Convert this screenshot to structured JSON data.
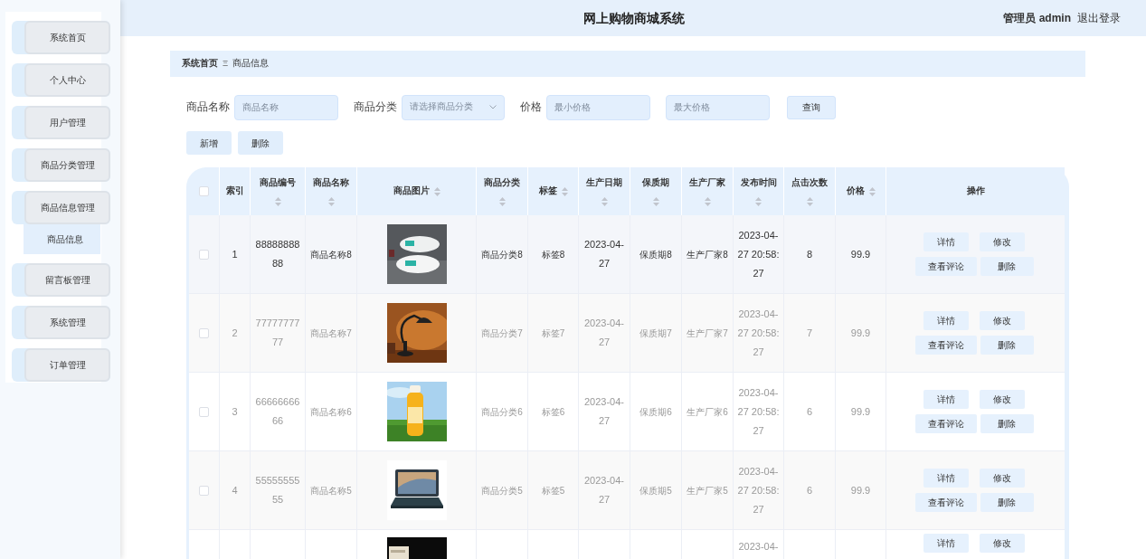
{
  "sidebar": {
    "items": [
      {
        "label": "系统首页",
        "selected": false
      },
      {
        "label": "个人中心",
        "selected": false
      },
      {
        "label": "用户管理",
        "selected": false
      },
      {
        "label": "商品分类管理",
        "selected": false
      },
      {
        "label": "商品信息管理",
        "selected": false,
        "children": [
          {
            "label": "商品信息",
            "selected": true
          }
        ]
      },
      {
        "label": "留言板管理",
        "selected": false
      },
      {
        "label": "系统管理",
        "selected": false
      },
      {
        "label": "订单管理",
        "selected": false
      }
    ]
  },
  "header": {
    "title": "网上购物商城系统",
    "user": "管理员 admin",
    "logout": "退出登录"
  },
  "breadcrumb": {
    "items": [
      "系统首页",
      "商品信息"
    ],
    "separator": "Ξ"
  },
  "search": {
    "fields": [
      {
        "kind": "text",
        "label": "商品名称",
        "placeholder": "商品名称"
      },
      {
        "kind": "select",
        "label": "商品分类",
        "placeholder": "请选择商品分类"
      },
      {
        "kind": "text",
        "label": "价格",
        "placeholder": "最小价格"
      },
      {
        "kind": "text",
        "placeholder": "最大价格"
      }
    ],
    "button": "查询"
  },
  "actions": [
    "新增",
    "删除"
  ],
  "table": {
    "header_checked": false,
    "columns": [
      {
        "label": "索引",
        "sortable": false
      },
      {
        "label": "商品编号",
        "sortable": true
      },
      {
        "label": "商品名称",
        "sortable": true
      },
      {
        "label": "商品图片",
        "sortable": true
      },
      {
        "label": "商品分类",
        "sortable": true
      },
      {
        "label": "标签",
        "sortable": true
      },
      {
        "label": "生产日期",
        "sortable": true
      },
      {
        "label": "保质期",
        "sortable": true
      },
      {
        "label": "生产厂家",
        "sortable": true
      },
      {
        "label": "发布时间",
        "sortable": true
      },
      {
        "label": "点击次数",
        "sortable": true
      },
      {
        "label": "价格",
        "sortable": true
      },
      {
        "label": "操作",
        "sortable": false
      }
    ],
    "rows": [
      {
        "checked": false,
        "highlighted": true,
        "cells": [
          "1",
          "8888888888",
          "商品名称8",
          {
            "kind": "picture"
          },
          "商品分类8",
          "标签8",
          "2023-04-27",
          "保质期8",
          "生产厂家8",
          "2023-04-27 20:58:27",
          "8",
          "99.9"
        ],
        "buttons": [
          "详情",
          "修改",
          "查看评论",
          "删除"
        ]
      },
      {
        "checked": false,
        "highlighted": false,
        "cells": [
          "2",
          "7777777777",
          "商品名称7",
          {
            "kind": "picture"
          },
          "商品分类7",
          "标签7",
          "2023-04-27",
          "保质期7",
          "生产厂家7",
          "2023-04-27 20:58:27",
          "7",
          "99.9"
        ],
        "buttons": [
          "详情",
          "修改",
          "查看评论",
          "删除"
        ]
      },
      {
        "checked": false,
        "highlighted": false,
        "cells": [
          "3",
          "6666666666",
          "商品名称6",
          {
            "kind": "picture"
          },
          "商品分类6",
          "标签6",
          "2023-04-27",
          "保质期6",
          "生产厂家6",
          "2023-04-27 20:58:27",
          "6",
          "99.9"
        ],
        "buttons": [
          "详情",
          "修改",
          "查看评论",
          "删除"
        ]
      },
      {
        "checked": false,
        "highlighted": false,
        "cells": [
          "4",
          "5555555555",
          "商品名称5",
          {
            "kind": "picture"
          },
          "商品分类5",
          "标签5",
          "2023-04-27",
          "保质期5",
          "生产厂家5",
          "2023-04-27 20:58:27",
          "6",
          "99.9"
        ],
        "buttons": [
          "详情",
          "修改",
          "查看评论",
          "删除"
        ]
      },
      {
        "cells": [
          null,
          null,
          null,
          {
            "kind": "picture"
          },
          null,
          null,
          null,
          null,
          null,
          "2023-04-",
          null,
          null
        ],
        "buttons": [
          "详情",
          "修改"
        ]
      }
    ]
  }
}
